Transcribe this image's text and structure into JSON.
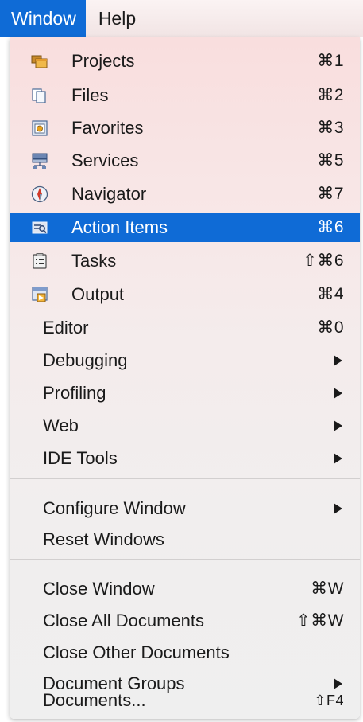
{
  "menubar": {
    "items": [
      {
        "label": "Window"
      },
      {
        "label": "Help"
      }
    ]
  },
  "menu": {
    "items": [
      {
        "label": "Projects",
        "shortcut": "⌘1",
        "icon": "projects-icon"
      },
      {
        "label": "Files",
        "shortcut": "⌘2",
        "icon": "files-icon"
      },
      {
        "label": "Favorites",
        "shortcut": "⌘3",
        "icon": "favorites-icon"
      },
      {
        "label": "Services",
        "shortcut": "⌘5",
        "icon": "services-icon"
      },
      {
        "label": "Navigator",
        "shortcut": "⌘7",
        "icon": "navigator-icon"
      },
      {
        "label": "Action Items",
        "shortcut": "⌘6",
        "icon": "action-items-icon",
        "highlighted": true
      },
      {
        "label": "Tasks",
        "shortcut": "⇧⌘6",
        "icon": "tasks-icon"
      },
      {
        "label": "Output",
        "shortcut": "⌘4",
        "icon": "output-icon"
      },
      {
        "label": "Editor",
        "shortcut": "⌘0"
      },
      {
        "label": "Debugging",
        "submenu": true
      },
      {
        "label": "Profiling",
        "submenu": true
      },
      {
        "label": "Web",
        "submenu": true
      },
      {
        "label": "IDE Tools",
        "submenu": true
      },
      {
        "label": "Configure Window",
        "submenu": true
      },
      {
        "label": "Reset Windows"
      },
      {
        "label": "Close Window",
        "shortcut": "⌘W"
      },
      {
        "label": "Close All Documents",
        "shortcut": "⇧⌘W"
      },
      {
        "label": "Close Other Documents"
      },
      {
        "label": "Document Groups",
        "submenu": true
      },
      {
        "label": "Documents...",
        "shortcut": "⇧F4"
      }
    ]
  },
  "colors": {
    "highlight": "#0f6bd6",
    "menu_top": "#f9dede",
    "menu_bottom": "#efefef"
  }
}
